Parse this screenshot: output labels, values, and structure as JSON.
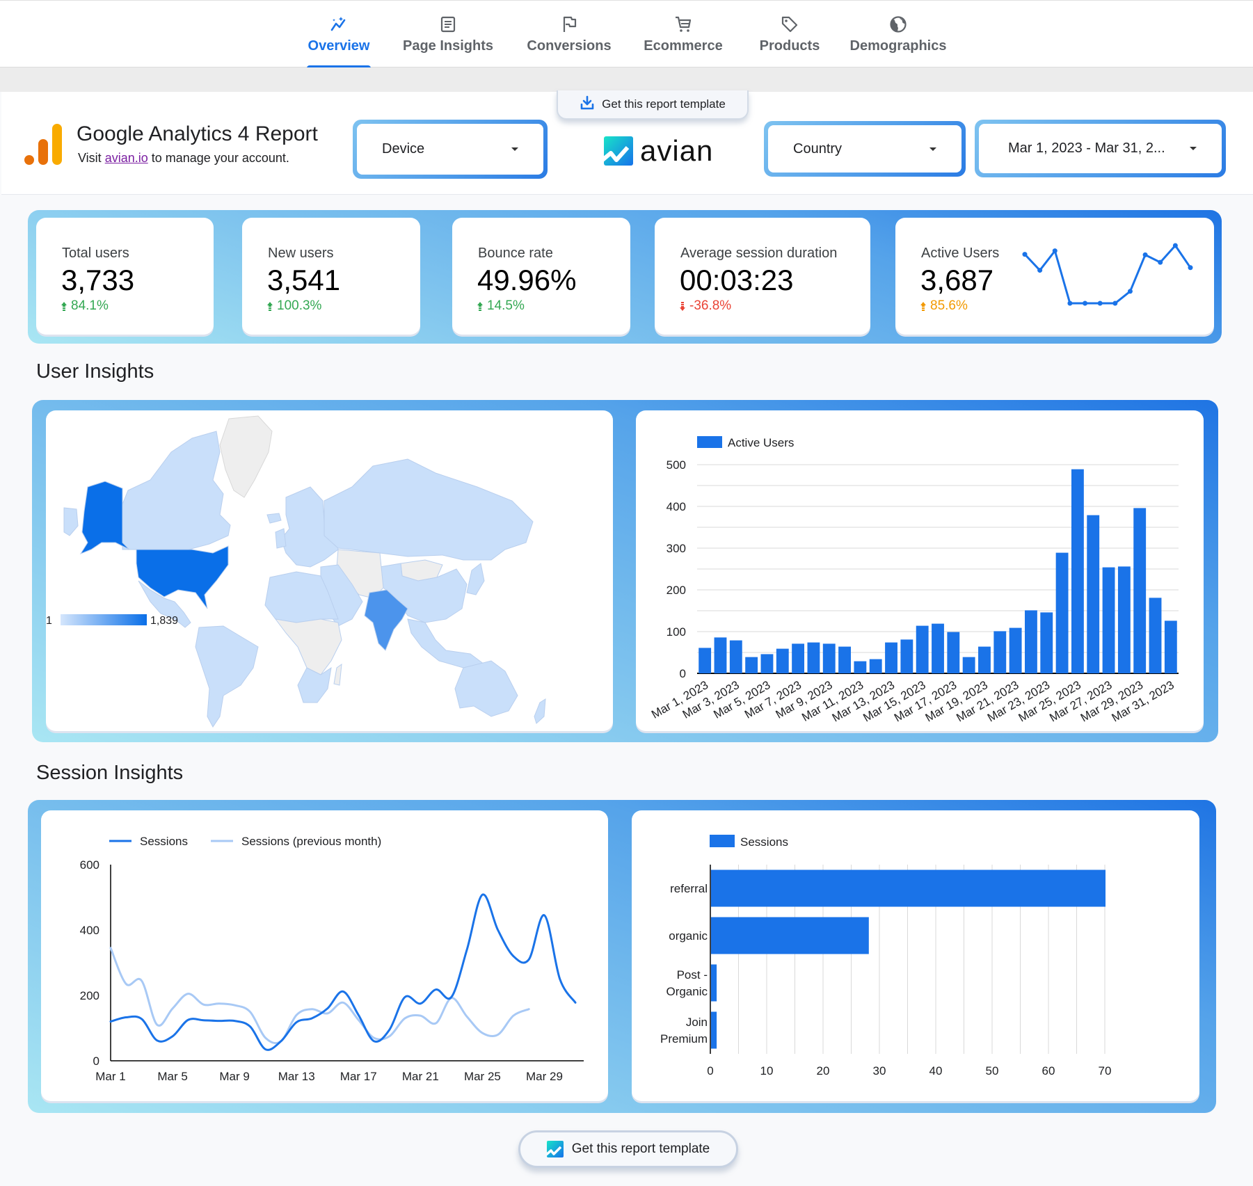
{
  "nav": {
    "tabs": [
      {
        "label": "Overview",
        "icon": "sparkle-trend-icon",
        "active": true
      },
      {
        "label": "Page Insights",
        "icon": "document-icon",
        "active": false
      },
      {
        "label": "Conversions",
        "icon": "flag-icon",
        "active": false
      },
      {
        "label": "Ecommerce",
        "icon": "cart-icon",
        "active": false
      },
      {
        "label": "Products",
        "icon": "tag-icon",
        "active": false
      },
      {
        "label": "Demographics",
        "icon": "globe-icon",
        "active": false
      }
    ]
  },
  "header": {
    "title": "Google Analytics 4 Report",
    "subtitle_prefix": "Visit ",
    "subtitle_link": "avian.io",
    "subtitle_suffix": " to manage your account.",
    "template_button_top": "Get this report template",
    "brand": "avian",
    "filters": {
      "device": "Device",
      "country": "Country",
      "date_range": "Mar 1, 2023 - Mar 31, 2..."
    }
  },
  "kpis": [
    {
      "label": "Total users",
      "value": "3,733",
      "delta": "84.1%",
      "direction": "up",
      "color": "#34a853"
    },
    {
      "label": "New users",
      "value": "3,541",
      "delta": "100.3%",
      "direction": "up",
      "color": "#34a853"
    },
    {
      "label": "Bounce rate",
      "value": "49.96%",
      "delta": "14.5%",
      "direction": "up",
      "color": "#34a853"
    },
    {
      "label": "Average session duration",
      "value": "00:03:23",
      "delta": "-36.8%",
      "direction": "down",
      "color": "#ea4335"
    },
    {
      "label": "Active Users",
      "value": "3,687",
      "delta": "85.6%",
      "direction": "up",
      "color": "#f29900"
    }
  ],
  "sparkline": {
    "values": [
      197,
      137,
      210,
      13,
      13,
      13,
      13,
      58,
      195,
      167,
      230,
      147
    ],
    "color": "#1a73e8"
  },
  "sections": {
    "user_insights": "User Insights",
    "session_insights": "Session Insights"
  },
  "map": {
    "legend_min": "1",
    "legend_max": "1,839",
    "highlighted": [
      {
        "country": "United States",
        "level": "high"
      },
      {
        "country": "India",
        "level": "medium"
      }
    ],
    "colors": {
      "high": "#0a6fe8",
      "medium": "#4c94ec",
      "low": "#c9dffa",
      "none": "#eeeeee"
    }
  },
  "chart_data": [
    {
      "type": "bar",
      "title": "",
      "legend": [
        "Active Users"
      ],
      "legend_position": "top-left",
      "xlabel": "",
      "ylabel": "",
      "ylim": [
        0,
        500
      ],
      "yticks": [
        0,
        100,
        200,
        300,
        400,
        500
      ],
      "grid": true,
      "categories": [
        "Mar 1, 2023",
        "Mar 2, 2023",
        "Mar 3, 2023",
        "Mar 4, 2023",
        "Mar 5, 2023",
        "Mar 6, 2023",
        "Mar 7, 2023",
        "Mar 8, 2023",
        "Mar 9, 2023",
        "Mar 10, 2023",
        "Mar 11, 2023",
        "Mar 12, 2023",
        "Mar 13, 2023",
        "Mar 14, 2023",
        "Mar 15, 2023",
        "Mar 16, 2023",
        "Mar 17, 2023",
        "Mar 18, 2023",
        "Mar 19, 2023",
        "Mar 20, 2023",
        "Mar 21, 2023",
        "Mar 22, 2023",
        "Mar 23, 2023",
        "Mar 24, 2023",
        "Mar 25, 2023",
        "Mar 26, 2023",
        "Mar 27, 2023",
        "Mar 28, 2023",
        "Mar 29, 2023",
        "Mar 30, 2023",
        "Mar 31, 2023"
      ],
      "tick_labels": [
        "Mar 1, 2023",
        "Mar 3, 2023",
        "Mar 5, 2023",
        "Mar 7, 2023",
        "Mar 9, 2023",
        "Mar 11, 2023",
        "Mar 13, 2023",
        "Mar 15, 2023",
        "Mar 17, 2023",
        "Mar 19, 2023",
        "Mar 21, 2023",
        "Mar 23, 2023",
        "Mar 25, 2023",
        "Mar 27, 2023",
        "Mar 29, 2023",
        "Mar 31, 2023"
      ],
      "values": [
        61,
        86,
        79,
        39,
        46,
        59,
        71,
        74,
        71,
        64,
        29,
        34,
        74,
        81,
        114,
        119,
        99,
        39,
        64,
        101,
        109,
        151,
        146,
        289,
        489,
        379,
        254,
        256,
        396,
        181,
        126
      ],
      "color": "#1a73e8"
    },
    {
      "type": "line",
      "title": "",
      "legend_position": "top-left",
      "xlabel": "",
      "ylabel": "",
      "ylim": [
        0,
        600
      ],
      "yticks": [
        0,
        200,
        400,
        600
      ],
      "grid": false,
      "x": [
        "Mar 1",
        "Mar 2",
        "Mar 3",
        "Mar 4",
        "Mar 5",
        "Mar 6",
        "Mar 7",
        "Mar 8",
        "Mar 9",
        "Mar 10",
        "Mar 11",
        "Mar 12",
        "Mar 13",
        "Mar 14",
        "Mar 15",
        "Mar 16",
        "Mar 17",
        "Mar 18",
        "Mar 19",
        "Mar 20",
        "Mar 21",
        "Mar 22",
        "Mar 23",
        "Mar 24",
        "Mar 25",
        "Mar 26",
        "Mar 27",
        "Mar 28",
        "Mar 29",
        "Mar 30",
        "Mar 31"
      ],
      "tick_labels": [
        "Mar 1",
        "Mar 5",
        "Mar 9",
        "Mar 13",
        "Mar 17",
        "Mar 21",
        "Mar 25",
        "Mar 29"
      ],
      "series": [
        {
          "name": "Sessions",
          "color": "#1a73e8",
          "values": [
            120,
            133,
            128,
            62,
            75,
            125,
            124,
            122,
            122,
            105,
            35,
            60,
            118,
            130,
            160,
            212,
            140,
            60,
            95,
            195,
            175,
            218,
            195,
            340,
            508,
            400,
            320,
            310,
            445,
            250,
            178
          ]
        },
        {
          "name": "Sessions (previous month)",
          "color": "#a8c9f5",
          "values": [
            345,
            235,
            245,
            110,
            160,
            205,
            172,
            175,
            170,
            150,
            70,
            60,
            140,
            158,
            145,
            178,
            125,
            70,
            75,
            130,
            138,
            115,
            192,
            135,
            85,
            80,
            138,
            158
          ]
        }
      ]
    },
    {
      "type": "bar",
      "orientation": "horizontal",
      "title": "",
      "legend": [
        "Sessions"
      ],
      "legend_position": "top-left",
      "xlabel": "",
      "ylabel": "",
      "xlim": [
        0,
        70
      ],
      "xticks": [
        0,
        10,
        20,
        30,
        40,
        50,
        60,
        70
      ],
      "grid": true,
      "categories": [
        "referral",
        "organic",
        "Post - Organic",
        "Join Premium"
      ],
      "category_lines": [
        [
          "referral"
        ],
        [
          "organic"
        ],
        [
          "Post -",
          "Organic"
        ],
        [
          "Join",
          "Premium"
        ]
      ],
      "values": [
        70,
        28,
        1,
        1
      ],
      "color": "#1a73e8"
    }
  ],
  "footer": {
    "template_button_bottom": "Get this report template"
  }
}
